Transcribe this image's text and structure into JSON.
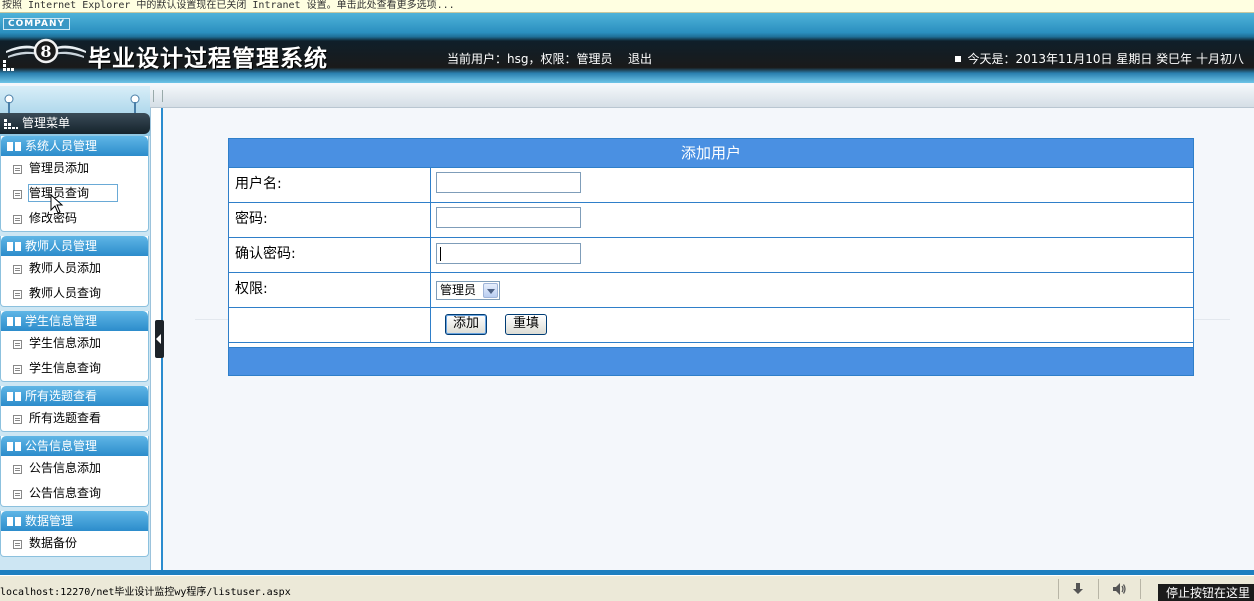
{
  "infobar": {
    "text": "按照 Internet Explorer 中的默认设置现在已关闭 Intranet 设置。单击此处查看更多选项..."
  },
  "header": {
    "company": "COMPANY",
    "title": "毕业设计过程管理系统",
    "user_info": "当前用户：hsg，权限：管理员",
    "logout": "退出",
    "date": "今天是：2013年11月10日 星期日 癸巳年 十月初八"
  },
  "sidebar": {
    "menu_title": "管理菜单",
    "groups": [
      {
        "title": "系统人员管理",
        "items": [
          "管理员添加",
          "管理员查询",
          "修改密码"
        ]
      },
      {
        "title": "教师人员管理",
        "items": [
          "教师人员添加",
          "教师人员查询"
        ]
      },
      {
        "title": "学生信息管理",
        "items": [
          "学生信息添加",
          "学生信息查询"
        ]
      },
      {
        "title": "所有选题查看",
        "items": [
          "所有选题查看"
        ]
      },
      {
        "title": "公告信息管理",
        "items": [
          "公告信息添加",
          "公告信息查询"
        ]
      },
      {
        "title": "数据管理",
        "items": [
          "数据备份"
        ]
      }
    ]
  },
  "form": {
    "title": "添加用户",
    "username_label": "用户名:",
    "username_value": "",
    "password_label": "密码:",
    "password_value": "",
    "confirm_label": "确认密码:",
    "confirm_value": "",
    "role_label": "权限:",
    "role_selected": "管理员",
    "add_button": "添加",
    "reset_button": "重填"
  },
  "statusbar": {
    "url": "localhost:12270/net毕业设计监控wy程序/listuser.aspx",
    "tooltip": "停止按钮在这里"
  },
  "colors": {
    "accent": "#4a90e2",
    "sidebar_group": "#2c8ccb",
    "border": "#2f7fc9"
  }
}
